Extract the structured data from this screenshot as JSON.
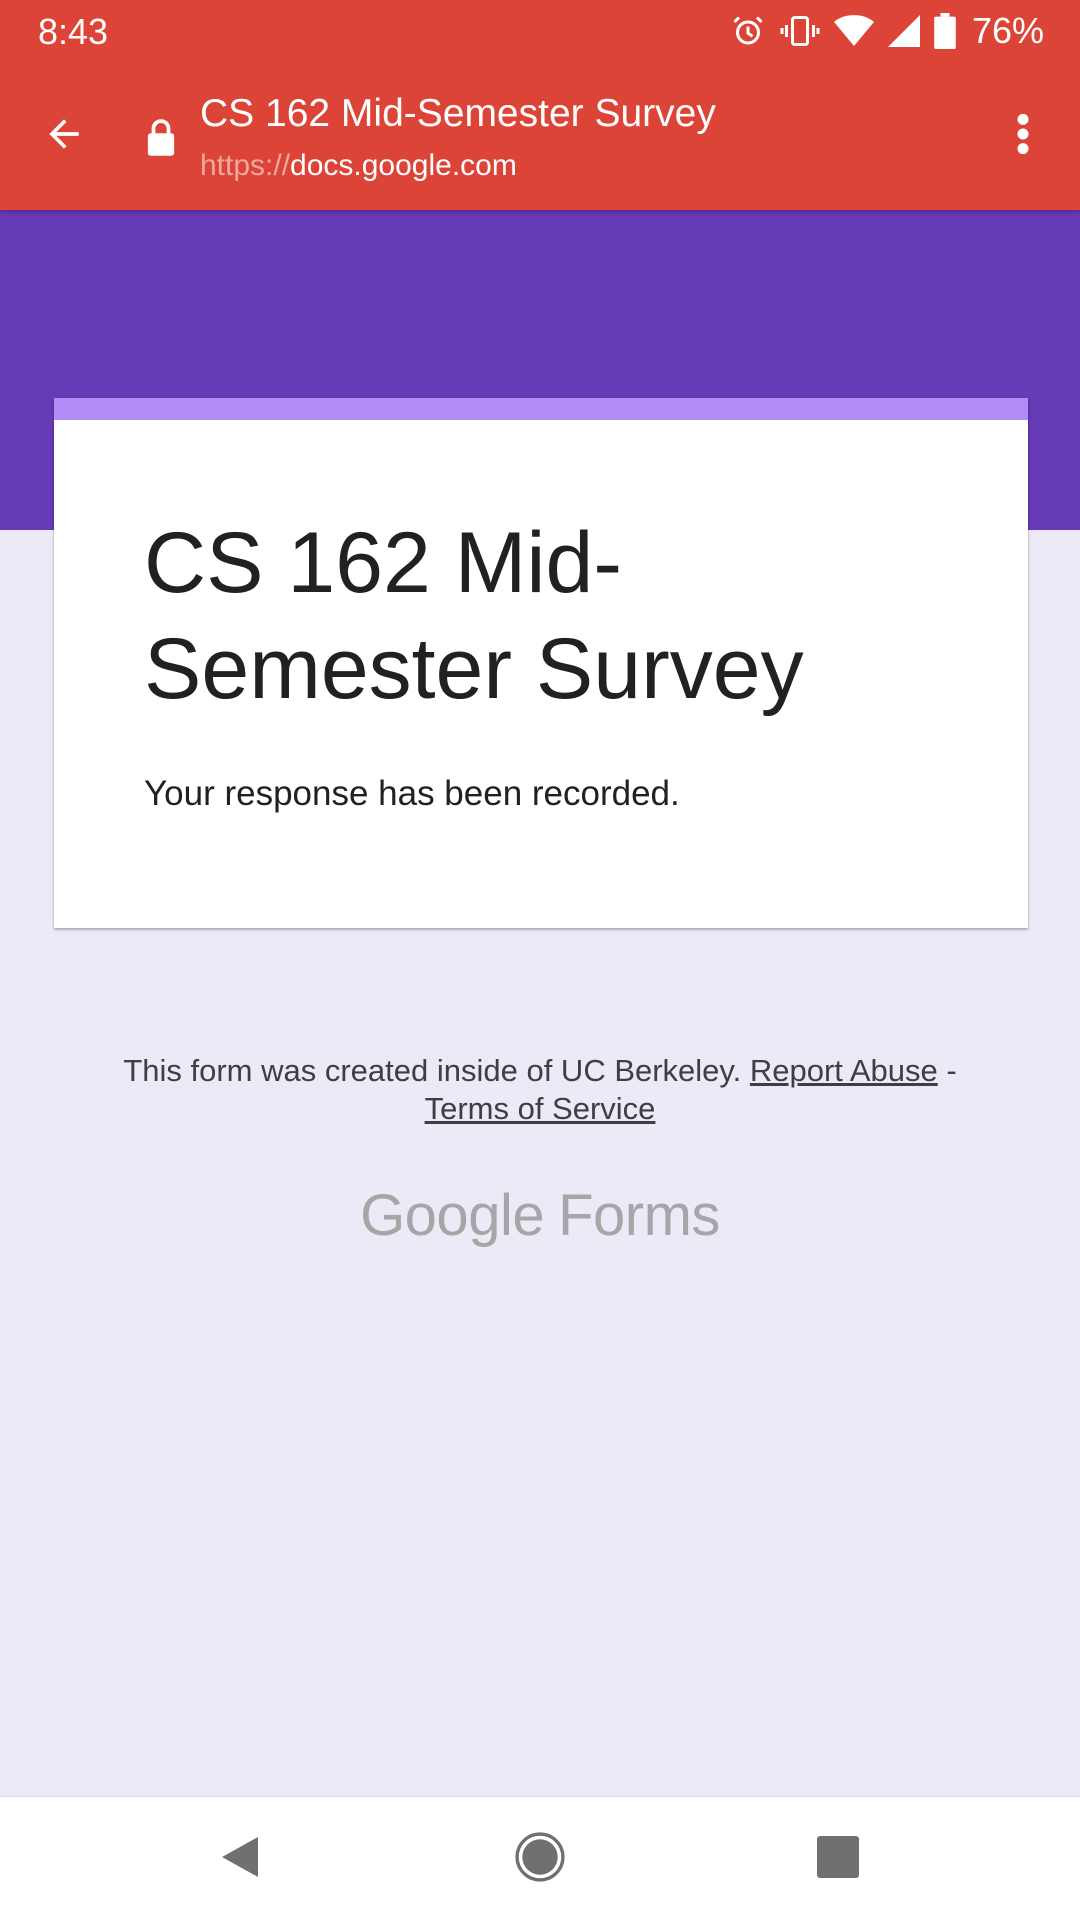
{
  "status_bar": {
    "time": "8:43",
    "battery_percent": "76%",
    "icons": [
      "alarm-icon",
      "vibrate-icon",
      "wifi-icon",
      "signal-icon",
      "battery-icon"
    ]
  },
  "browser": {
    "page_title": "CS 162 Mid-Semester Survey",
    "url_scheme": "https://",
    "url_host": "docs.google.com",
    "icons": [
      "back-arrow-icon",
      "lock-icon",
      "more-vert-icon"
    ]
  },
  "form": {
    "title": "CS 162 Mid-Semester Survey",
    "confirmation": "Your response has been recorded.",
    "colors": {
      "header": "#673ab7",
      "accent": "#b48cf7",
      "background": "#ede9f7"
    }
  },
  "footer": {
    "notice": "This form was created inside of UC Berkeley.",
    "report_abuse": "Report Abuse",
    "separator": "-",
    "terms": "Terms of Service",
    "logo_google": "Google",
    "logo_forms": "Forms"
  },
  "navbar": {
    "icons": [
      "nav-back-icon",
      "nav-home-icon",
      "nav-recents-icon"
    ]
  },
  "theme": {
    "toolbar_color": "#db4437"
  }
}
